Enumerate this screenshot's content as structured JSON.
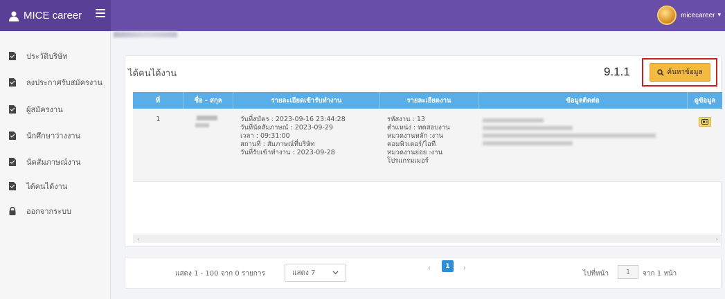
{
  "app": {
    "brand": "MICE career",
    "username": "micecareer"
  },
  "sidebar": {
    "items": [
      {
        "label": "ประวัติบริษัท"
      },
      {
        "label": "ลงประกาศรับสมัครงาน"
      },
      {
        "label": "ผู้สมัครงาน"
      },
      {
        "label": "นักศึกษาว่างงาน"
      },
      {
        "label": "นัดสัมภาษณ์งาน"
      },
      {
        "label": "ได้คนได้งาน"
      },
      {
        "label": "ออกจากระบบ"
      }
    ]
  },
  "main": {
    "title": "ได้คนได้งาน",
    "annotation": "9.1.1",
    "search_label": "ค้นหาข้อมูล",
    "table": {
      "headers": [
        "ที่",
        "ชื่อ - สกุล",
        "รายละเอียดเข้ารับทำงาน",
        "รายละเอียดงาน",
        "ข้อมูลติดต่อ",
        "ดูข้อมูล"
      ],
      "rows": [
        {
          "index": "1",
          "details": [
            "วันที่สมัคร : 2023-09-16 23:44:28",
            "วันที่นัดสัมภาษณ์ : 2023-09-29",
            "เวลา : 09:31:00",
            "สถานที่ : สัมภาษณ์ที่บริษัท",
            "วันที่รับเข้าทำงาน : 2023-09-28"
          ],
          "job": [
            "รหัสงาน : 13",
            "ตำแหน่ง : ทดสอบงาน",
            "หมวดงานหลัก :งาน",
            "คอมพิวเตอร์/ไอที",
            "หมวดงานย่อย :งาน",
            "โปรแกรมเมอร์"
          ]
        }
      ]
    }
  },
  "pager": {
    "summary": "แสดง 1 - 100 จาก 0 รายการ",
    "per_page": "แสดง 7",
    "current_page": "1",
    "goto_label": "ไปที่หน้า",
    "goto_value": "1",
    "goto_total": "จาก 1 หน้า"
  }
}
